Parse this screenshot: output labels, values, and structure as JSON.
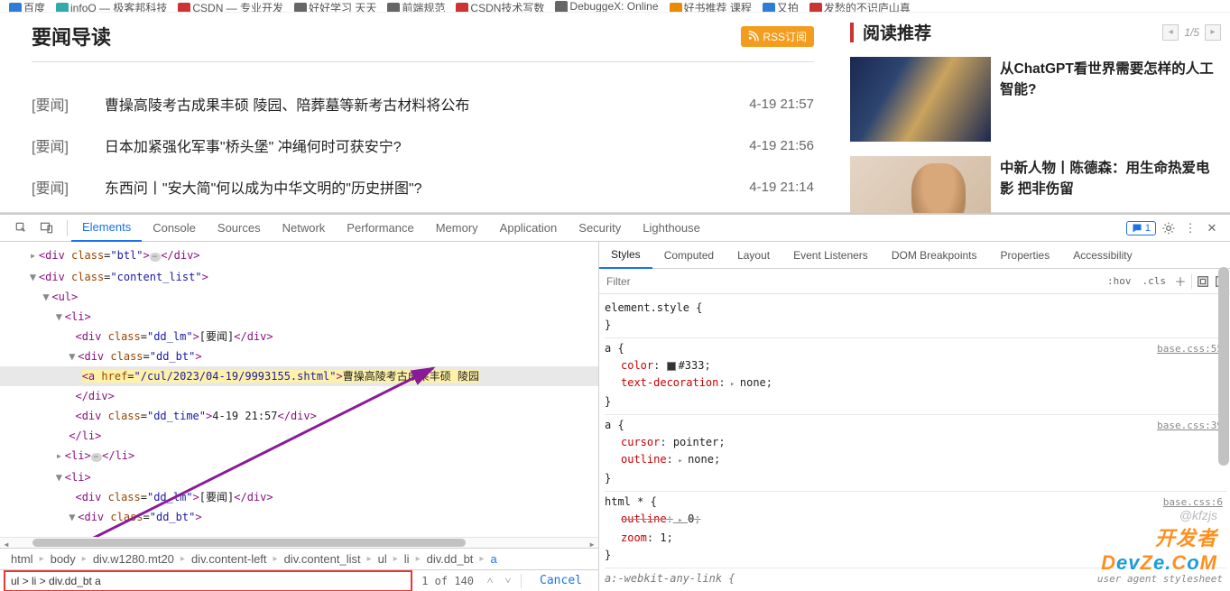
{
  "bookmarks": [
    "百度",
    "infoQ — 极客邦科技",
    "CSDN — 专业开发",
    "好好学习 天天",
    "前端规范",
    "CSDN技术写数",
    "DebuggeX: Online",
    "好书推荐 课程",
    "又拍",
    "发愁的不识庐山真"
  ],
  "news": {
    "section_title": "要闻导读",
    "rss_label": "RSS订阅",
    "items": [
      {
        "tag": "[要闻]",
        "title": "曹操高陵考古成果丰硕 陵园、陪葬墓等新考古材料将公布",
        "time": "4-19 21:57"
      },
      {
        "tag": "[要闻]",
        "title": "日本加紧强化军事\"桥头堡\" 冲绳何时可获安宁?",
        "time": "4-19 21:56"
      },
      {
        "tag": "[要闻]",
        "title": "东西问丨\"安大简\"何以成为中华文明的\"历史拼图\"?",
        "time": "4-19 21:14"
      }
    ]
  },
  "recommend": {
    "title": "阅读推荐",
    "pager": "1/5",
    "items": [
      {
        "title": "从ChatGPT看世界需要怎样的人工智能?"
      },
      {
        "title": "中新人物丨陈德森：用生命热爱电影 把非伤留"
      }
    ]
  },
  "devtools": {
    "tabs": [
      "Elements",
      "Console",
      "Sources",
      "Network",
      "Performance",
      "Memory",
      "Application",
      "Security",
      "Lighthouse"
    ],
    "active_tab": "Elements",
    "msg_count": "1",
    "styles_tabs": [
      "Styles",
      "Computed",
      "Layout",
      "Event Listeners",
      "DOM Breakpoints",
      "Properties",
      "Accessibility"
    ],
    "active_styles_tab": "Styles",
    "filter_placeholder": "Filter",
    "hov_label": ":hov",
    "cls_label": ".cls",
    "elements_tree": {
      "l0": "<div class=\"btl\">",
      "l1": "<div class=\"content_list\">",
      "l2": "<ul>",
      "l3": "<li>",
      "l4": "<div class=\"dd_lm\">",
      "l4t": "[要闻]",
      "l5": "<div class=\"dd_bt\">",
      "hl_href": "/cul/2023/04-19/9993155.shtml",
      "hl_text": "曹操高陵考古成果丰硕 陵园",
      "l7": "</div>",
      "l8": "<div class=\"dd_time\">",
      "l8t": "4-19 21:57",
      "l9": "</li>",
      "l10": "<li>",
      "l11": "<li>",
      "l12": "<div class=\"dd_lm\">",
      "l12t": "[要闻]",
      "l13": "<div class=\"dd_bt\">"
    },
    "breadcrumb": [
      "html",
      "body",
      "div.w1280.mt20",
      "div.content-left",
      "div.content_list",
      "ul",
      "li",
      "div.dd_bt",
      "a"
    ],
    "search_value": "ul > li > div.dd_bt a",
    "search_count": "1 of 140",
    "cancel_label": "Cancel",
    "styles": {
      "elem_style": "element.style",
      "rules": [
        {
          "selector": "a",
          "src": "base.css:55",
          "props": [
            {
              "name": "color",
              "value": "#333",
              "swatch": true
            },
            {
              "name": "text-decoration",
              "value": "none",
              "expand": true
            }
          ]
        },
        {
          "selector": "a",
          "src": "base.css:39",
          "props": [
            {
              "name": "cursor",
              "value": "pointer"
            },
            {
              "name": "outline",
              "value": "none",
              "expand": true
            }
          ]
        },
        {
          "selector": "html *",
          "src": "base.css:6",
          "props": [
            {
              "name": "outline",
              "value": "0",
              "strike": true,
              "expand": true
            },
            {
              "name": "zoom",
              "value": "1"
            }
          ]
        }
      ],
      "ua_rule_sel": "a:-webkit-any-link",
      "ua_label": "user agent stylesheet"
    }
  },
  "watermark_credit": "@kfzjs",
  "watermark_logo_a": "开发者",
  "watermark_logo_b": "DevZe.CoM"
}
